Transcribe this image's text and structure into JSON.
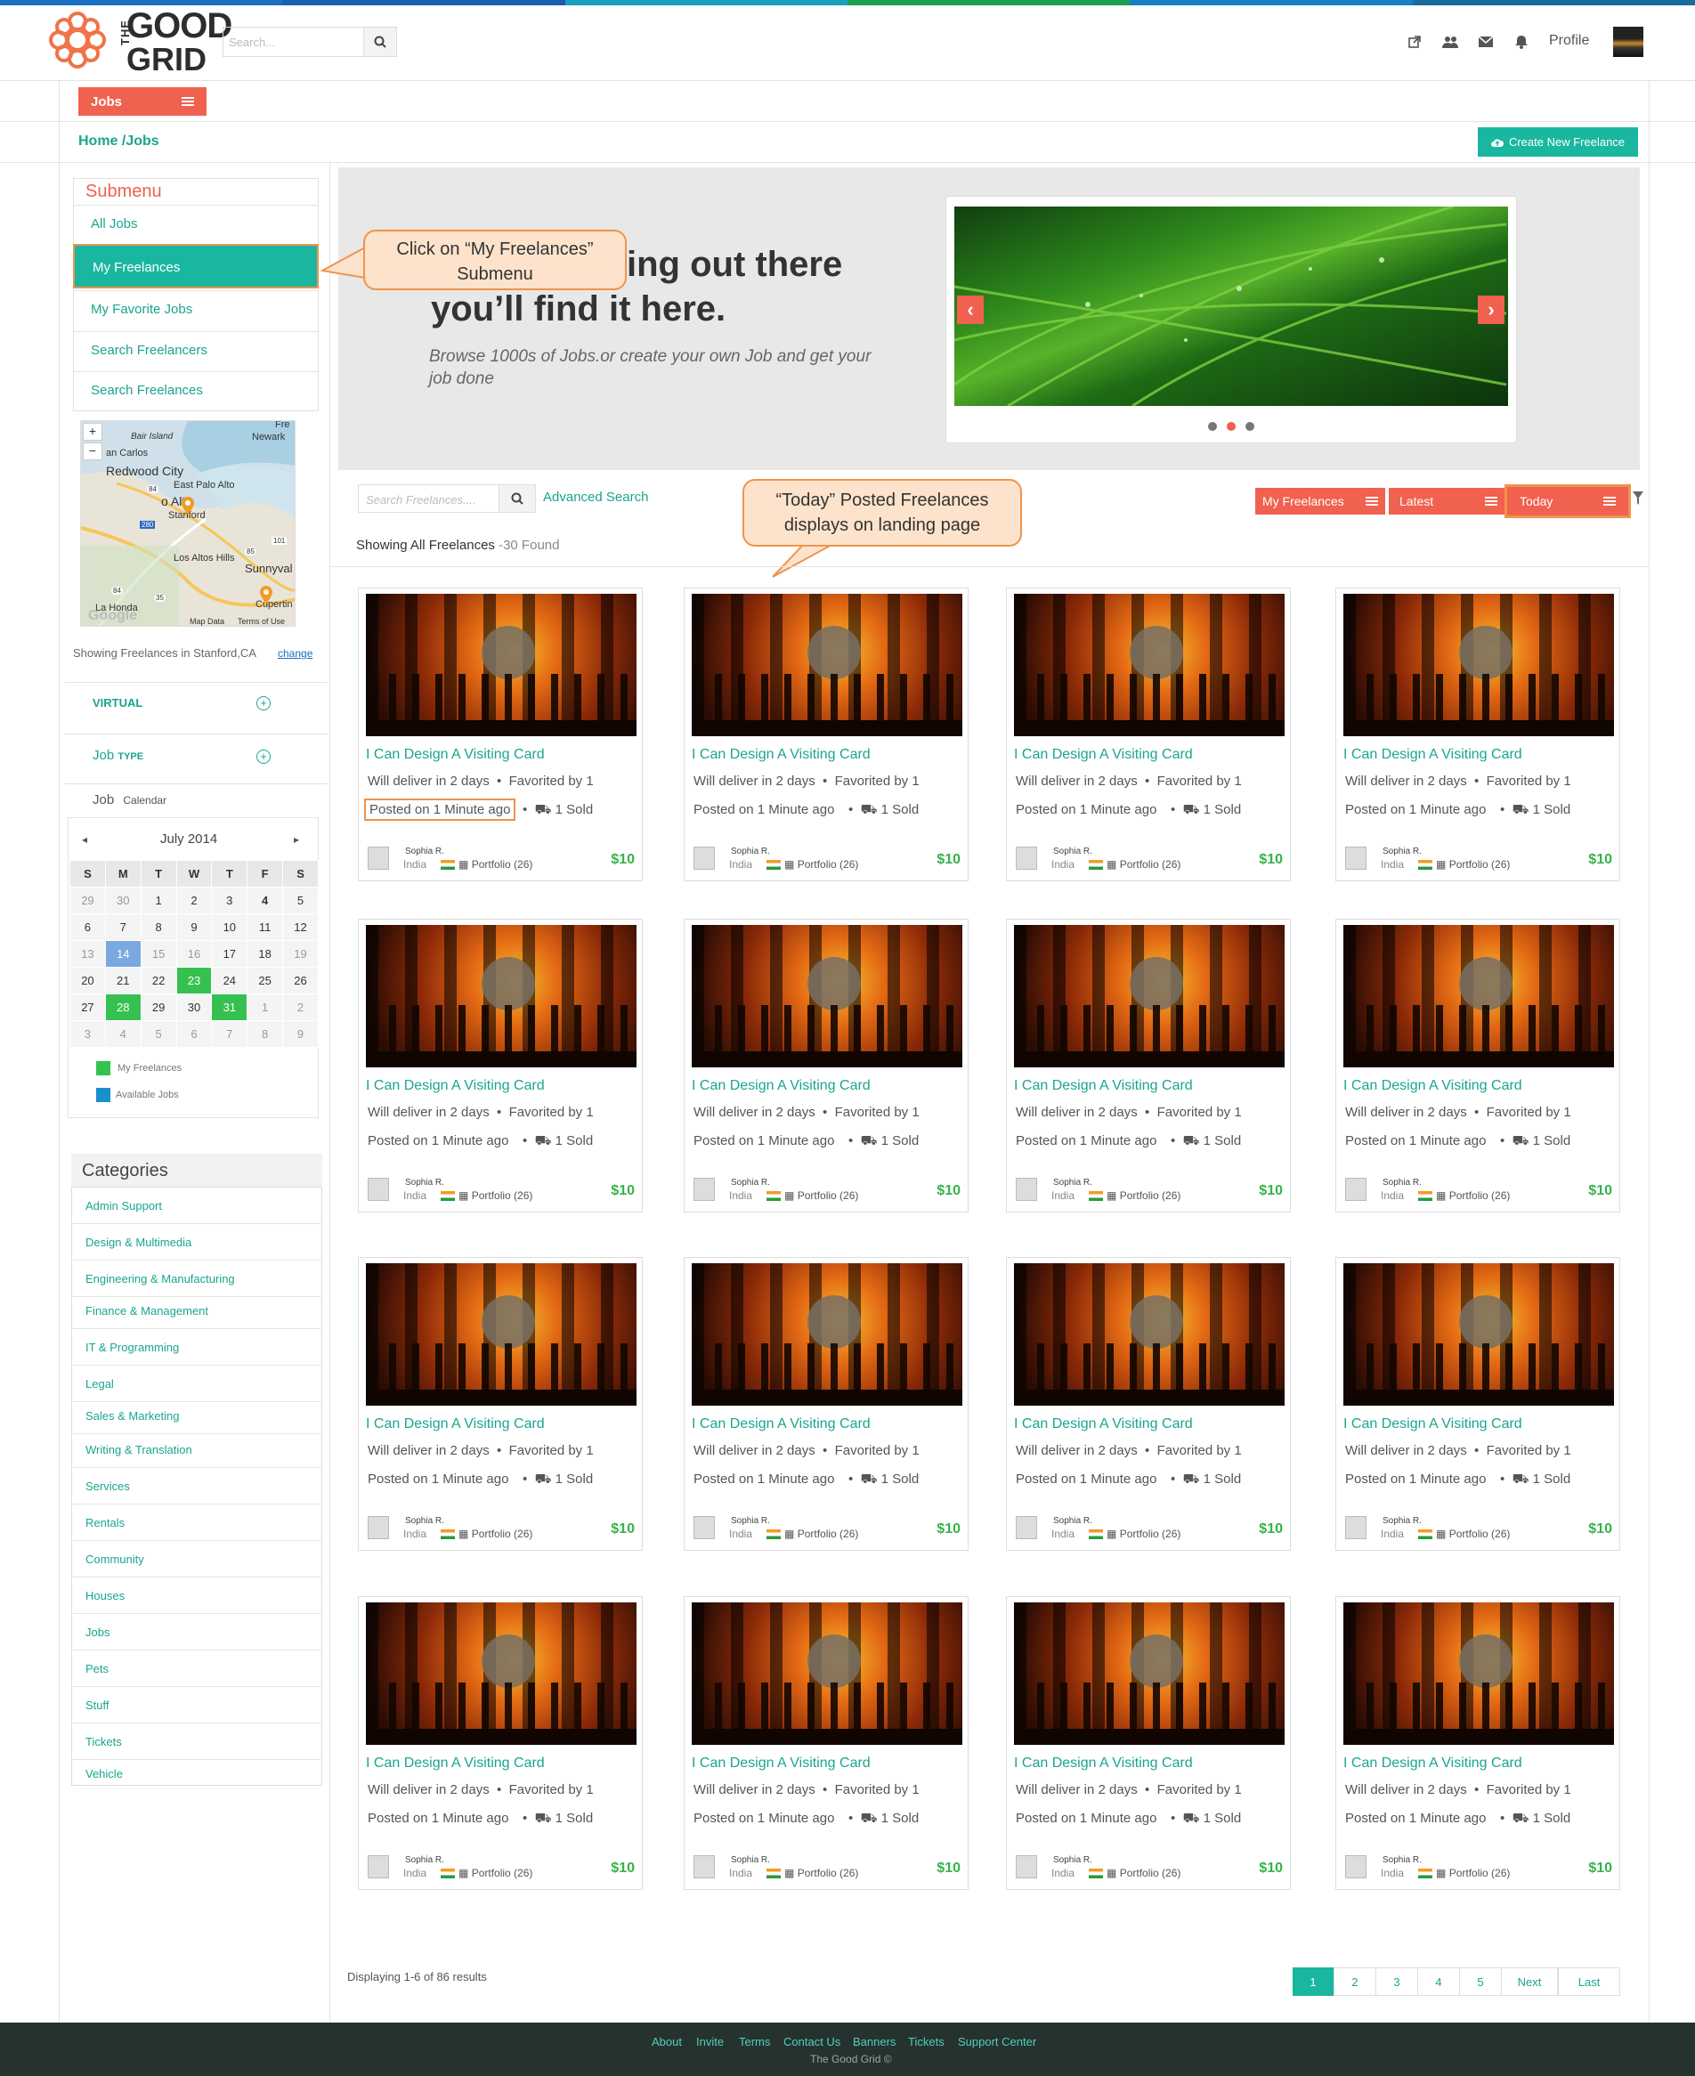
{
  "header": {
    "logo_the": "THE",
    "logo_good": "GOOD",
    "logo_grid": "GRID",
    "search_placeholder": "Search...",
    "profile_label": "Profile",
    "icons": [
      "external-link-icon",
      "users-icon",
      "envelope-icon",
      "bell-icon"
    ]
  },
  "nav": {
    "jobs_label": "Jobs",
    "breadcrumb": "Home /Jobs",
    "create_button": "Create New Freelance"
  },
  "submenu": {
    "title": "Submenu",
    "items": [
      {
        "label": "All Jobs"
      },
      {
        "label": "My Freelances"
      },
      {
        "label": "My Favorite Jobs"
      },
      {
        "label": "Search Freelancers"
      },
      {
        "label": "Search Freelances"
      }
    ]
  },
  "callouts": {
    "submenu_callout_line1": "Click on “My Freelances”",
    "submenu_callout_line2": "Submenu",
    "today_callout_line1": "“Today” Posted Freelances",
    "today_callout_line2": "displays on landing page"
  },
  "map": {
    "labels": [
      "Bair Island",
      "Newark",
      "an Carlos",
      "Redwood City",
      "East Palo Alto",
      "o Alto",
      "Stanford",
      "Los Altos Hills",
      "Sunnyval",
      "La Honda",
      "Cupertin",
      "Map Data",
      "Terms of Use",
      "Google",
      "Fre"
    ],
    "road_numbers": [
      "84",
      "280",
      "101",
      "85",
      "84",
      "35"
    ],
    "showing_text": "Showing Freelances in Stanford,CA",
    "change_link": "change"
  },
  "filters": {
    "virtual": "VIRTUAL",
    "job_type_1": "Job",
    "job_type_2": "TYPE",
    "job_calendar_1": "Job",
    "job_calendar_2": "Calendar"
  },
  "calendar": {
    "month": "July 2014",
    "weekdays": [
      "S",
      "M",
      "T",
      "W",
      "T",
      "F",
      "S"
    ],
    "weeks": [
      [
        "29",
        "30",
        "1",
        "2",
        "3",
        "4",
        "5"
      ],
      [
        "6",
        "7",
        "8",
        "9",
        "10",
        "11",
        "12"
      ],
      [
        "13",
        "14",
        "15",
        "16",
        "17",
        "18",
        "19"
      ],
      [
        "20",
        "21",
        "22",
        "23",
        "24",
        "25",
        "26"
      ],
      [
        "27",
        "28",
        "29",
        "30",
        "31",
        "1",
        "2"
      ],
      [
        "3",
        "4",
        "5",
        "6",
        "7",
        "8",
        "9"
      ]
    ],
    "legend_my": "My Freelances",
    "legend_available": "Available Jobs",
    "color_my": "#35c14f",
    "color_available": "#1a8fd0"
  },
  "categories": {
    "title": "Categories",
    "items": [
      "Admin Support",
      "Design & Multimedia",
      "Engineering & Manufacturing",
      "Finance & Management",
      "IT & Programming",
      "Legal",
      "Sales & Marketing",
      "Writing & Translation",
      "Services",
      "Rentals",
      "Community",
      "Houses",
      "Jobs",
      "Pets",
      "Stuff",
      "Tickets",
      "Vehicle"
    ]
  },
  "hero": {
    "heading_line1": "ing out there",
    "heading_line2": "you’ll find it here.",
    "subtext": "Browse 1000s of Jobs.or create your own Job and get your job done"
  },
  "toolbar": {
    "search_placeholder": "Search Freelances....",
    "advanced": "Advanced Search",
    "btn_my": "My Freelances",
    "btn_latest": "Latest",
    "btn_today": "Today",
    "showing": "Showing All Freelances",
    "found": " -30 Found"
  },
  "card": {
    "title": "I Can Design A Visiting Card",
    "deliver": "Will deliver in 2 days",
    "favorited": "Favorited by 1",
    "posted": "Posted on 1 Minute ago",
    "sold": "1 Sold",
    "name": "Sophia R.",
    "country": "India",
    "portfolio": "Portfolio (26)",
    "price": "$10"
  },
  "pagination": {
    "displaying": "Displaying 1-6 of 86 results",
    "pages": [
      "1",
      "2",
      "3",
      "4",
      "5",
      "Next",
      "Last"
    ]
  },
  "footer": {
    "links": [
      "About",
      "Invite",
      "Terms",
      "Contact Us",
      "Banners",
      "Tickets",
      "Support Center"
    ],
    "copyright": "The Good Grid ©"
  },
  "colors": {
    "accent_teal": "#1ab7a0",
    "accent_orange": "#f0614f",
    "highlight_border": "#f0934a",
    "footer_bg": "#26322e"
  }
}
